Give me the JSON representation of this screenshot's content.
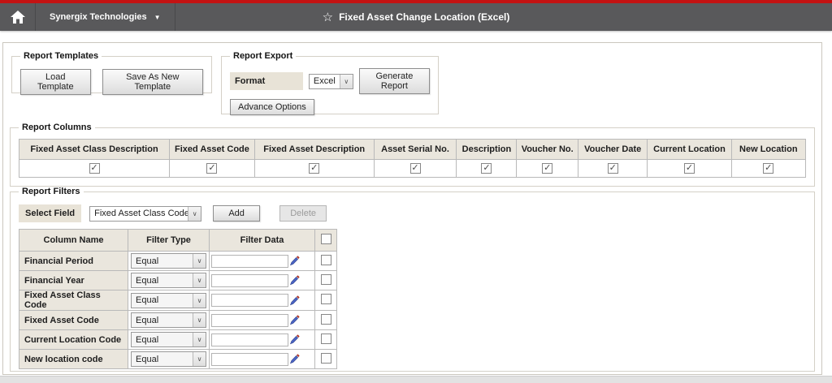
{
  "colors": {
    "accent_red": "#c31212",
    "header_gray": "#59595b",
    "label_tan": "#e8e3d7"
  },
  "icons": {
    "favorite_star": "☆",
    "menu_arrow": "▼",
    "select_arrow": "∨"
  },
  "header": {
    "menu_label": "Synergix Technologies",
    "title": "Fixed Asset Change Location (Excel)"
  },
  "report_templates": {
    "legend": "Report Templates",
    "load_button": "Load Template",
    "save_button": "Save As New Template"
  },
  "report_export": {
    "legend": "Report Export",
    "format_label": "Format",
    "format_value": "Excel",
    "generate_button": "Generate Report",
    "advance_button": "Advance Options"
  },
  "report_columns": {
    "legend": "Report Columns",
    "columns": [
      "Fixed Asset Class Description",
      "Fixed Asset Code",
      "Fixed Asset Description",
      "Asset Serial No.",
      "Description",
      "Voucher No.",
      "Voucher Date",
      "Current Location",
      "New Location"
    ],
    "checked": [
      true,
      true,
      true,
      true,
      true,
      true,
      true,
      true,
      true
    ]
  },
  "report_filters": {
    "legend": "Report Filters",
    "select_field_label": "Select Field",
    "select_field_value": "Fixed Asset Class Code",
    "add_button": "Add",
    "delete_button": "Delete",
    "table_headers": [
      "Column Name",
      "Filter Type",
      "Filter Data"
    ],
    "select_all_checked": false,
    "rows": [
      {
        "name": "Financial Period",
        "filter_type": "Equal",
        "filter_data": "",
        "checked": false
      },
      {
        "name": "Financial Year",
        "filter_type": "Equal",
        "filter_data": "",
        "checked": false
      },
      {
        "name": "Fixed Asset Class Code",
        "filter_type": "Equal",
        "filter_data": "",
        "checked": false
      },
      {
        "name": "Fixed Asset Code",
        "filter_type": "Equal",
        "filter_data": "",
        "checked": false
      },
      {
        "name": "Current Location Code",
        "filter_type": "Equal",
        "filter_data": "",
        "checked": false
      },
      {
        "name": "New location code",
        "filter_type": "Equal",
        "filter_data": "",
        "checked": false
      }
    ]
  }
}
